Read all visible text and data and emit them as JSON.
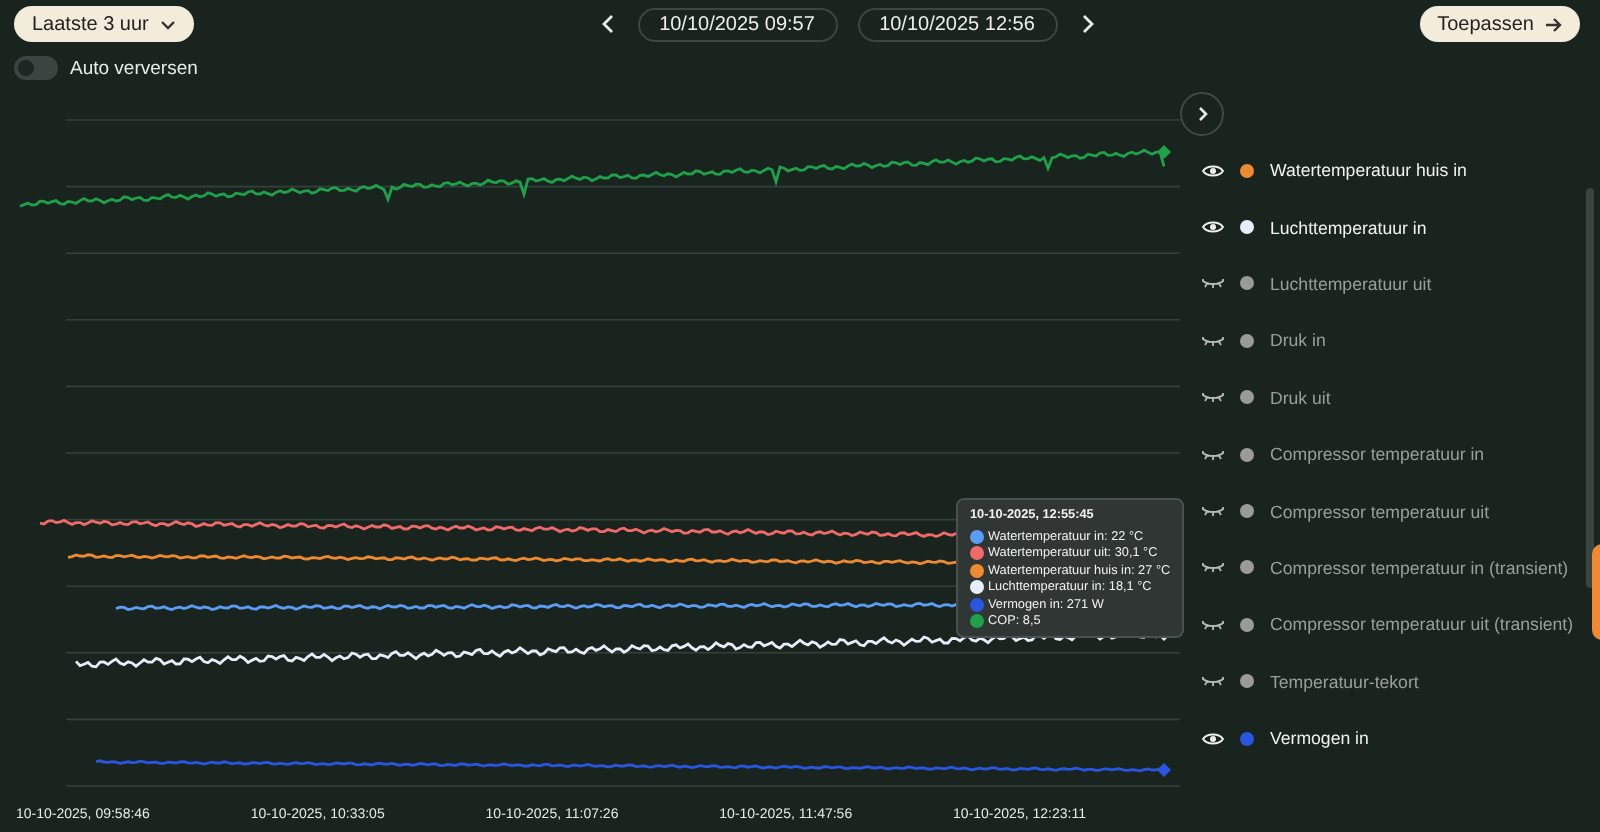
{
  "toolbar": {
    "range_button": "Laatste 3 uur",
    "start": "10/10/2025 09:57",
    "end": "10/10/2025 12:56",
    "apply_button": "Toepassen"
  },
  "auto_refresh": {
    "label": "Auto verversen",
    "on": false
  },
  "chart": {
    "x_labels": [
      "10-10-2025, 09:58:46",
      "10-10-2025, 10:33:05",
      "10-10-2025, 11:07:26",
      "10-10-2025, 11:47:56",
      "10-10-2025, 12:23:11"
    ],
    "tooltip": {
      "title": "10-10-2025, 12:55:45",
      "items": [
        {
          "text": "Watertemperatuur in: 22 °C",
          "color": "#5b9cf5"
        },
        {
          "text": "Watertemperatuur uit: 30,1 °C",
          "color": "#f06a6a"
        },
        {
          "text": "Watertemperatuur huis in: 27 °C",
          "color": "#f08a30"
        },
        {
          "text": "Luchttemperatuur in: 18,1 °C",
          "color": "#e6eefa"
        },
        {
          "text": "Vermogen in: 271 W",
          "color": "#2a55e0"
        },
        {
          "text": "COP: 8,5",
          "color": "#1fa04a"
        }
      ]
    }
  },
  "legend": [
    {
      "label": "Watertemperatuur huis in",
      "color": "#f08a30",
      "visible": true
    },
    {
      "label": "Luchttemperatuur in",
      "color": "#e6eefa",
      "visible": true
    },
    {
      "label": "Luchttemperatuur uit",
      "color": "#9a9a9a",
      "visible": false
    },
    {
      "label": "Druk in",
      "color": "#9a9a9a",
      "visible": false
    },
    {
      "label": "Druk uit",
      "color": "#9a9a9a",
      "visible": false
    },
    {
      "label": "Compressor temperatuur in",
      "color": "#9a9a9a",
      "visible": false
    },
    {
      "label": "Compressor temperatuur uit",
      "color": "#9a9a9a",
      "visible": false
    },
    {
      "label": "Compressor temperatuur in (transient)",
      "color": "#9a9a9a",
      "visible": false
    },
    {
      "label": "Compressor temperatuur uit (transient)",
      "color": "#9a9a9a",
      "visible": false
    },
    {
      "label": "Temperatuur-tekort",
      "color": "#9a9a9a",
      "visible": false
    },
    {
      "label": "Vermogen in",
      "color": "#2a55e0",
      "visible": true
    }
  ]
}
